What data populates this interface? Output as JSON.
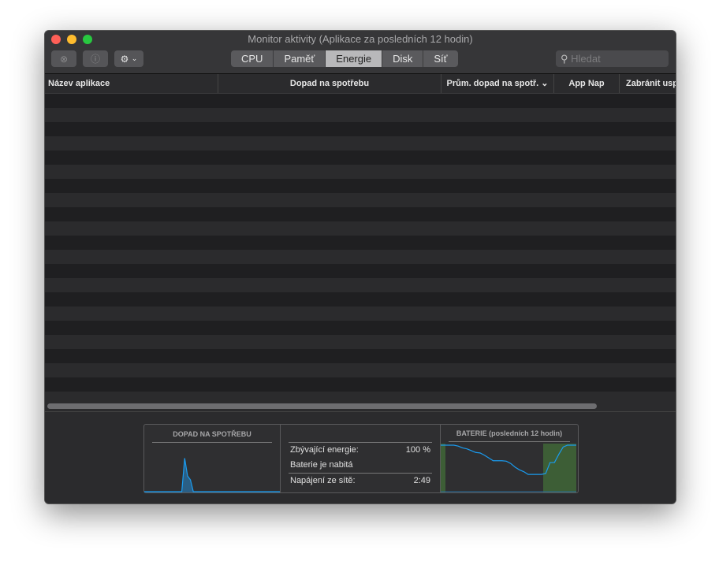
{
  "window": {
    "title": "Monitor aktivity (Aplikace za posledních 12 hodin)"
  },
  "toolbar": {
    "stop_icon": "x-circle-icon",
    "info_icon": "info-icon",
    "gear_icon": "gear-icon",
    "gear_caret": "⌄",
    "tabs": [
      {
        "label": "CPU"
      },
      {
        "label": "Paměť"
      },
      {
        "label": "Energie",
        "selected": true
      },
      {
        "label": "Disk"
      },
      {
        "label": "Síť"
      }
    ],
    "search": {
      "placeholder": "Hledat",
      "icon": "search-icon"
    }
  },
  "table": {
    "columns": [
      "Název aplikace",
      "Dopad na spotřebu",
      "Prům. dopad na spotř. ⌄",
      "App Nap",
      "Zabránit usp"
    ],
    "rows": []
  },
  "summary": {
    "impact_title": "DOPAD NA SPOTŘEBU",
    "battery_title": "BATERIE (posledních 12 hodin)",
    "remaining_label": "Zbývající energie:",
    "remaining_value": "100 %",
    "status": "Baterie je nabitá",
    "ac_label": "Napájení ze sítě:",
    "ac_value": "2:49",
    "accent": "#1a9cf0",
    "charging_color": "#3d5e36",
    "impact_points": [
      0,
      0,
      0,
      0,
      0,
      0,
      0,
      0,
      0,
      0,
      0,
      0,
      0,
      0,
      0.85,
      0.4,
      0.3,
      0,
      0,
      0,
      0,
      0,
      0,
      0,
      0,
      0,
      0,
      0,
      0,
      0,
      0,
      0,
      0,
      0,
      0,
      0,
      0,
      0,
      0,
      0,
      0,
      0,
      0,
      0,
      0,
      0,
      0,
      0
    ],
    "battery_percent": [
      100,
      100,
      100,
      100,
      98,
      94,
      92,
      88,
      84,
      83,
      78,
      72,
      66,
      66,
      66,
      65,
      60,
      52,
      46,
      42,
      36,
      36,
      36,
      36,
      38,
      62,
      62,
      80,
      96,
      100,
      100,
      100
    ]
  }
}
